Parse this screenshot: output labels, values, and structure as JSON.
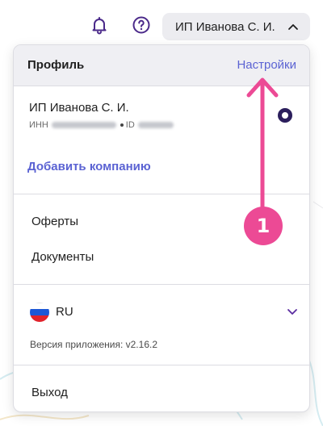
{
  "header": {
    "bell_icon": "bell-icon",
    "help_icon": "help-circle-icon",
    "user_button_label": "ИП Иванова С. И.",
    "chevron_icon": "chevron-up-icon"
  },
  "dropdown": {
    "title": "Профиль",
    "settings_link": "Настройки",
    "company": {
      "name": "ИП Иванова С. И.",
      "inn_label": "ИНН",
      "id_label": "ID",
      "selected": true
    },
    "add_company": "Добавить компанию",
    "menu": [
      "Оферты",
      "Документы"
    ],
    "language": {
      "code": "RU",
      "flag_icon": "russia-flag-icon"
    },
    "version": "Версия приложения: v2.16.2",
    "logout": "Выход"
  },
  "annotation": {
    "step_number": "1"
  },
  "colors": {
    "accent": "#5b63d3",
    "header_icons": "#4b2a8a",
    "badge": "#ec4a95",
    "radio": "#2b1e5c"
  }
}
